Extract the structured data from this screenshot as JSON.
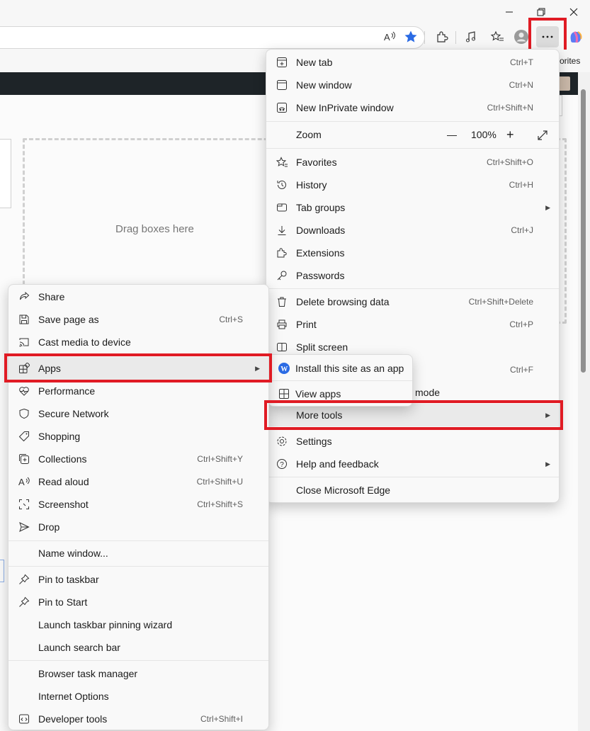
{
  "window": {
    "minimize_icon": "minimize-icon",
    "restore_icon": "restore-icon",
    "close_icon": "close-icon"
  },
  "favorites_bar": {
    "text": "orites"
  },
  "page": {
    "drop_zone_text": "Drag boxes here"
  },
  "main_menu": {
    "new_tab": {
      "label": "New tab",
      "shortcut": "Ctrl+T"
    },
    "new_window": {
      "label": "New window",
      "shortcut": "Ctrl+N"
    },
    "new_inprivate": {
      "label": "New InPrivate window",
      "shortcut": "Ctrl+Shift+N"
    },
    "zoom": {
      "label": "Zoom",
      "minus": "—",
      "value": "100%",
      "plus": "+"
    },
    "favorites": {
      "label": "Favorites",
      "shortcut": "Ctrl+Shift+O"
    },
    "history": {
      "label": "History",
      "shortcut": "Ctrl+H"
    },
    "tab_groups": {
      "label": "Tab groups"
    },
    "downloads": {
      "label": "Downloads",
      "shortcut": "Ctrl+J"
    },
    "extensions": {
      "label": "Extensions"
    },
    "passwords": {
      "label": "Passwords"
    },
    "delete_browsing": {
      "label": "Delete browsing data",
      "shortcut": "Ctrl+Shift+Delete"
    },
    "print": {
      "label": "Print",
      "shortcut": "Ctrl+P"
    },
    "split_screen": {
      "label": "Split screen"
    },
    "find_shortcut": "Ctrl+F",
    "mode_text": "mode",
    "more_tools": {
      "label": "More tools"
    },
    "settings": {
      "label": "Settings"
    },
    "help": {
      "label": "Help and feedback"
    },
    "close_edge": {
      "label": "Close Microsoft Edge"
    }
  },
  "apps_submenu": {
    "install_site": {
      "label": "Install this site as an app"
    },
    "view_apps": {
      "label": "View apps"
    }
  },
  "more_tools_menu": {
    "share": {
      "label": "Share"
    },
    "save_page": {
      "label": "Save page as",
      "shortcut": "Ctrl+S"
    },
    "cast": {
      "label": "Cast media to device"
    },
    "apps": {
      "label": "Apps"
    },
    "performance": {
      "label": "Performance"
    },
    "secure_network": {
      "label": "Secure Network"
    },
    "shopping": {
      "label": "Shopping"
    },
    "collections": {
      "label": "Collections",
      "shortcut": "Ctrl+Shift+Y"
    },
    "read_aloud": {
      "label": "Read aloud",
      "shortcut": "Ctrl+Shift+U"
    },
    "screenshot": {
      "label": "Screenshot",
      "shortcut": "Ctrl+Shift+S"
    },
    "drop": {
      "label": "Drop"
    },
    "name_window": {
      "label": "Name window..."
    },
    "pin_taskbar": {
      "label": "Pin to taskbar"
    },
    "pin_start": {
      "label": "Pin to Start"
    },
    "launch_wizard": {
      "label": "Launch taskbar pinning wizard"
    },
    "launch_search": {
      "label": "Launch search bar"
    },
    "task_manager": {
      "label": "Browser task manager"
    },
    "internet_options": {
      "label": "Internet Options"
    },
    "dev_tools": {
      "label": "Developer tools",
      "shortcut": "Ctrl+Shift+I"
    }
  },
  "colors": {
    "highlight_red": "#e01b24",
    "accent_blue": "#2b6be4"
  }
}
